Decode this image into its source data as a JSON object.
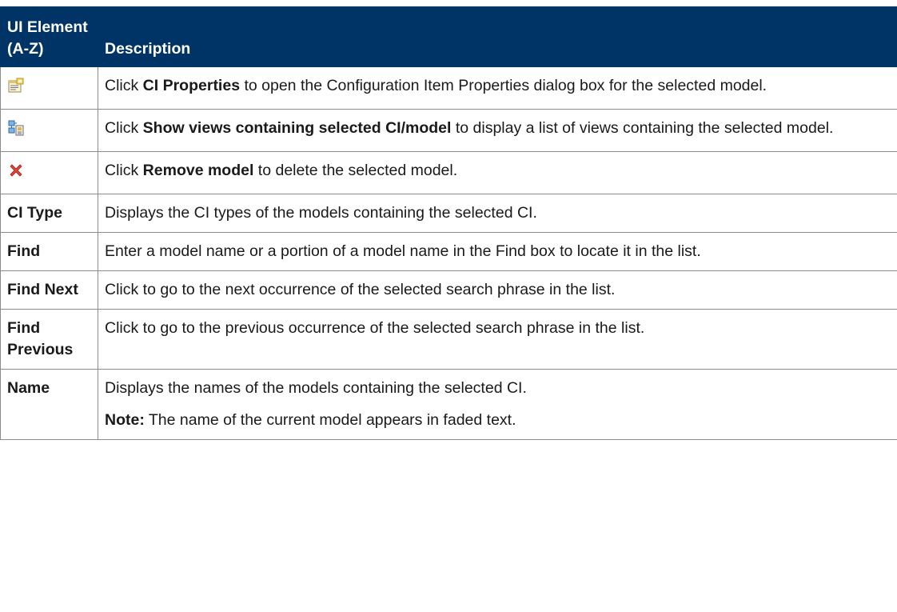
{
  "table": {
    "header": {
      "element_col": "UI Element (A-Z)",
      "description_col": "Description"
    },
    "rows": [
      {
        "element_icon": "ci-properties-icon",
        "description": {
          "prefix": "Click ",
          "bold": "CI Properties",
          "suffix": " to open the Configuration Item Properties dialog box for the selected model."
        }
      },
      {
        "element_icon": "show-views-icon",
        "description": {
          "prefix": "Click ",
          "bold": "Show views containing selected CI/model",
          "suffix": " to display a list of views containing the selected model."
        }
      },
      {
        "element_icon": "remove-model-icon",
        "description": {
          "prefix": "Click ",
          "bold": "Remove model",
          "suffix": " to delete the selected model."
        }
      },
      {
        "element": "CI Type",
        "description": {
          "text": "Displays the CI types of the models containing the selected CI."
        }
      },
      {
        "element": "Find",
        "description": {
          "text": "Enter a model name or a portion of a model name in the Find box to locate it in the list."
        }
      },
      {
        "element": "Find Next",
        "description": {
          "text": "Click to go to the next occurrence of the selected search phrase in the list."
        }
      },
      {
        "element": "Find Previous",
        "description": {
          "text": "Click to go to the previous occurrence of the selected search phrase in the list."
        }
      },
      {
        "element": "Name",
        "description": {
          "text": "Displays the names of the models containing the selected CI.",
          "note_label": "Note:",
          "note_text": " The name of the current model appears in faded text."
        }
      }
    ]
  },
  "colors": {
    "header_bg": "#003466",
    "header_text": "#ffffff",
    "border": "#8c8c8c"
  }
}
